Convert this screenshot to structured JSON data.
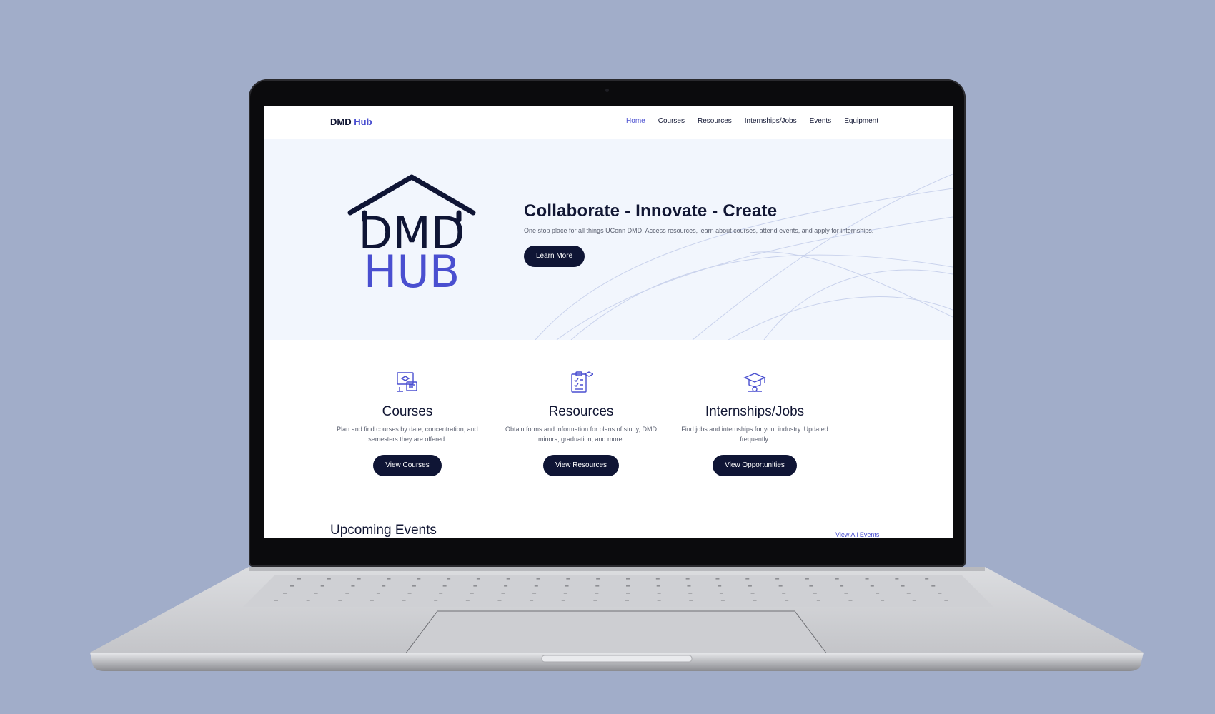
{
  "colors": {
    "background": "#a1adc9",
    "navy": "#0f1535",
    "accent": "#4a4fd0",
    "hero_bg": "#f2f6fd"
  },
  "navbar": {
    "brand_primary": "DMD",
    "brand_accent": "Hub",
    "links": [
      "Home",
      "Courses",
      "Resources",
      "Internships/Jobs",
      "Events",
      "Equipment"
    ],
    "active_link": "Home"
  },
  "hero": {
    "logo_line1": "DMD",
    "logo_line2": "HUB",
    "title": "Collaborate - Innovate - Create",
    "subtitle": "One stop place for all things UConn DMD. Access resources, learn about courses, attend events, and apply for internships.",
    "button": "Learn More"
  },
  "cards": [
    {
      "icon": "courses-computer-icon",
      "title": "Courses",
      "description": "Plan and find courses by date, concentration, and semesters they are offered.",
      "button": "View Courses"
    },
    {
      "icon": "resources-clipboard-icon",
      "title": "Resources",
      "description": "Obtain forms and information for plans of study, DMD minors, graduation, and more.",
      "button": "View Resources"
    },
    {
      "icon": "graduation-cap-icon",
      "title": "Internships/Jobs",
      "description": "Find jobs and internships for your industry. Updated frequently.",
      "button": "View Opportunities"
    }
  ],
  "events": {
    "title": "Upcoming Events",
    "view_all": "View All Events"
  }
}
